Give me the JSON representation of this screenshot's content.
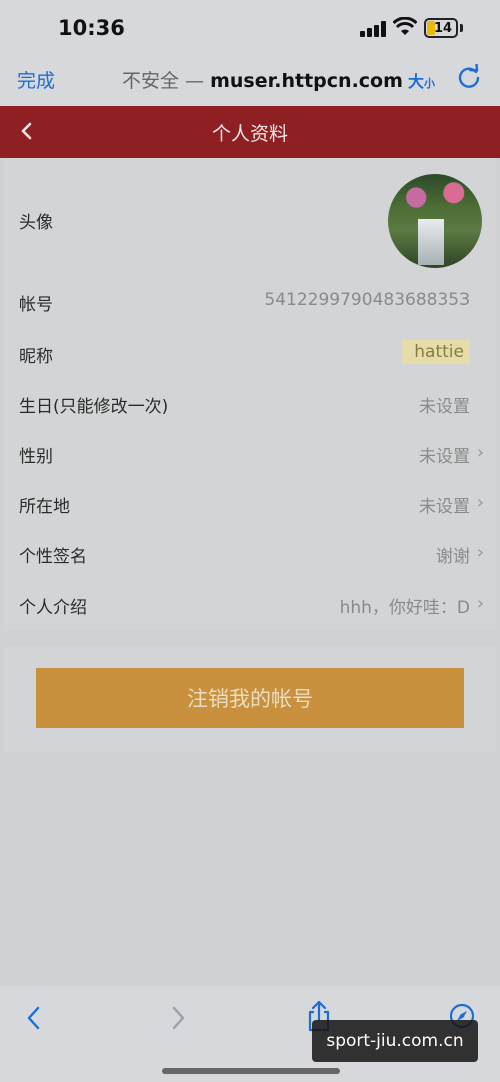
{
  "status_bar": {
    "time": "10:36",
    "battery": "14"
  },
  "browser": {
    "done_label": "完成",
    "security_label": "不安全 —",
    "domain": "muser.httpcn.com",
    "textsize_big": "大",
    "textsize_small": "小"
  },
  "header": {
    "title": "个人资料"
  },
  "profile": {
    "avatar_label": "头像",
    "account_label": "帐号",
    "account_value": "541229979048368835З",
    "nickname_label": "昵称",
    "nickname_value": "hattie",
    "birthday_label": "生日(只能修改一次)",
    "birthday_value": "未设置",
    "gender_label": "性别",
    "gender_value": "未设置",
    "location_label": "所在地",
    "location_value": "未设置",
    "signature_label": "个性签名",
    "signature_value": "谢谢",
    "intro_label": "个人介绍",
    "intro_value": "hhh，你好哇：D"
  },
  "actions": {
    "cancel_account_label": "注销我的帐号"
  },
  "watermark": "sport-jiu.com.cn",
  "colors": {
    "header_bg": "#8e1f22",
    "cancel_button_bg": "#c9913d",
    "link_blue": "#1a6ed8"
  }
}
